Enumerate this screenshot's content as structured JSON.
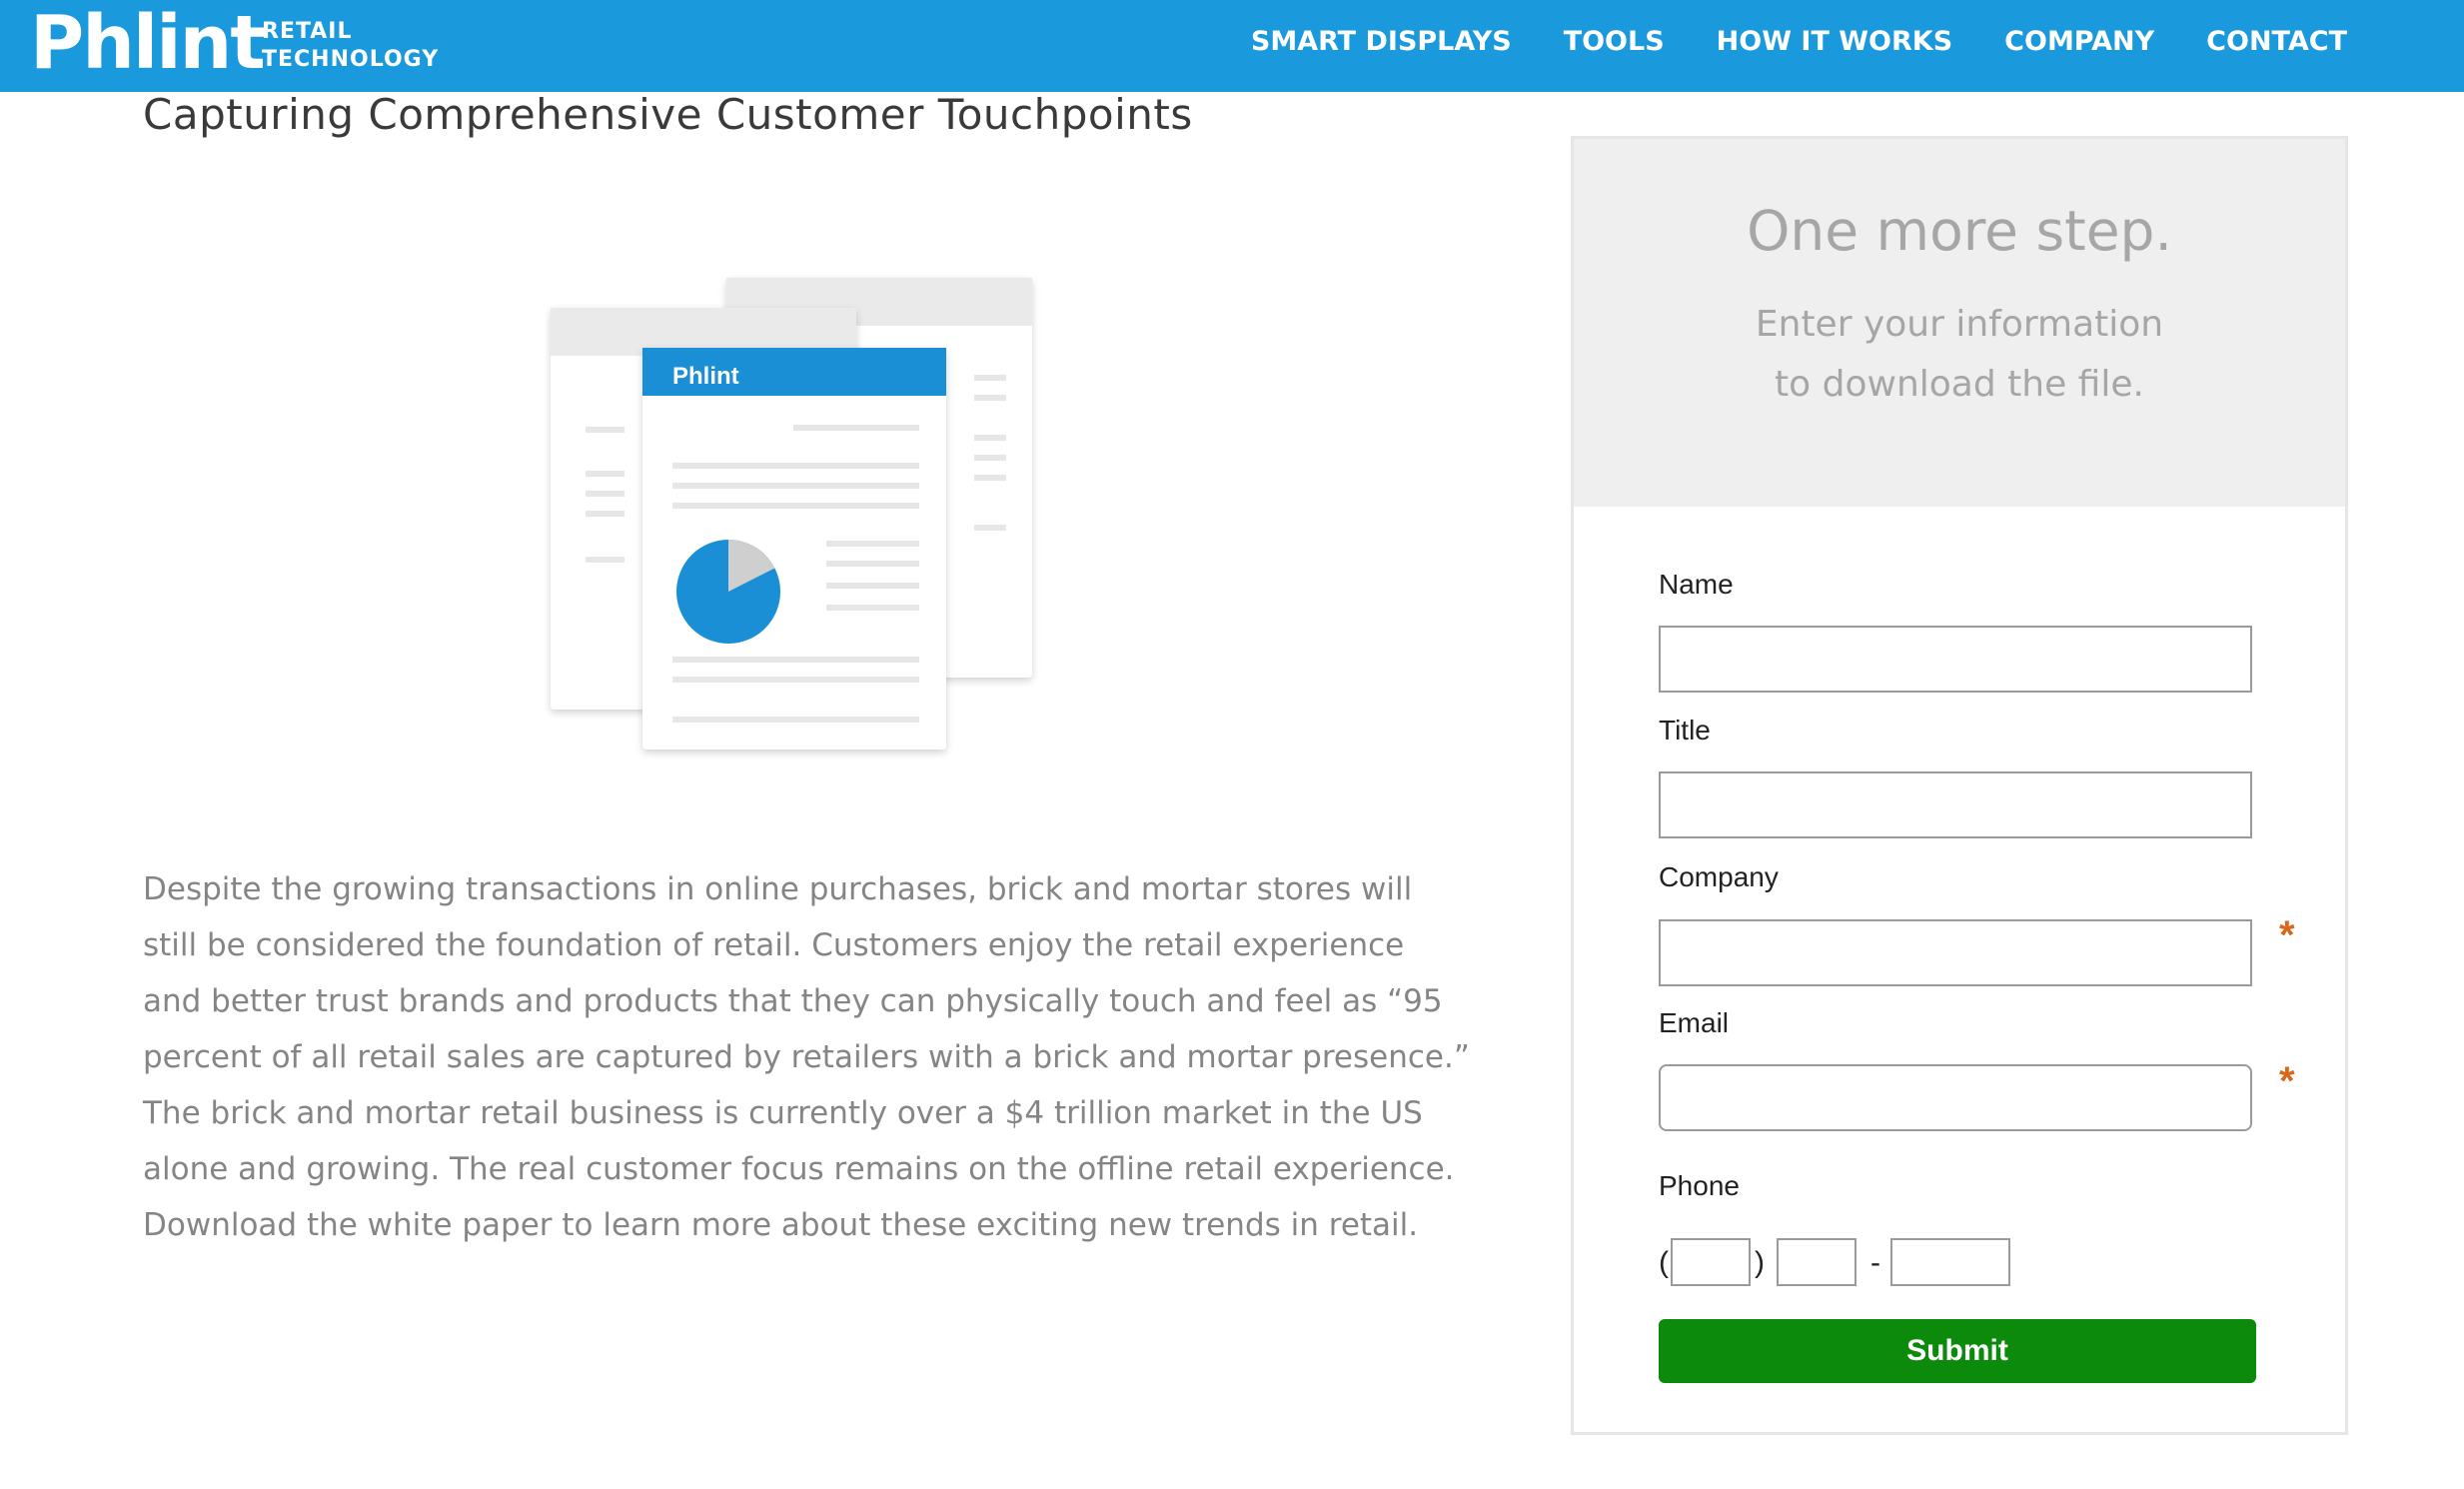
{
  "header": {
    "logo": "Phlint",
    "tagline_line1": "RETAIL",
    "tagline_line2": "TECHNOLOGY",
    "nav": [
      {
        "label": "SMART DISPLAYS"
      },
      {
        "label": "TOOLS"
      },
      {
        "label": "HOW IT WORKS"
      },
      {
        "label": "COMPANY"
      },
      {
        "label": "CONTACT"
      }
    ]
  },
  "main": {
    "title": "Capturing Comprehensive Customer Touchpoints",
    "illustration": {
      "doc_header_label": "Phlint"
    },
    "body": "Despite the growing transactions in online purchases, brick and mortar stores will still be considered the foundation of retail. Customers enjoy the retail experience and better trust brands and products that they can physically touch and feel as “95 percent of all retail sales are captured by retailers with a brick and mortar presence.” The brick and mortar retail business is currently over a $4 trillion market in the US alone and growing. The real customer focus remains on the offline retail experience. Download the white paper to learn more about these exciting new trends in retail."
  },
  "form": {
    "heading": "One more step.",
    "subtext_line1": "Enter your information",
    "subtext_line2": "to download the file.",
    "fields": {
      "name": {
        "label": "Name",
        "value": ""
      },
      "title": {
        "label": "Title",
        "value": ""
      },
      "company": {
        "label": "Company",
        "value": "",
        "required": true
      },
      "email": {
        "label": "Email",
        "value": "",
        "required": true
      },
      "phone": {
        "label": "Phone",
        "area": "",
        "prefix": "",
        "line": ""
      }
    },
    "required_marker": "*",
    "phone_open": "(",
    "phone_close": ")",
    "phone_dash": "-",
    "submit_label": "Submit"
  },
  "colors": {
    "brand_blue": "#1a99dc",
    "submit_green": "#0c8a0c",
    "required_orange": "#d9671b"
  }
}
